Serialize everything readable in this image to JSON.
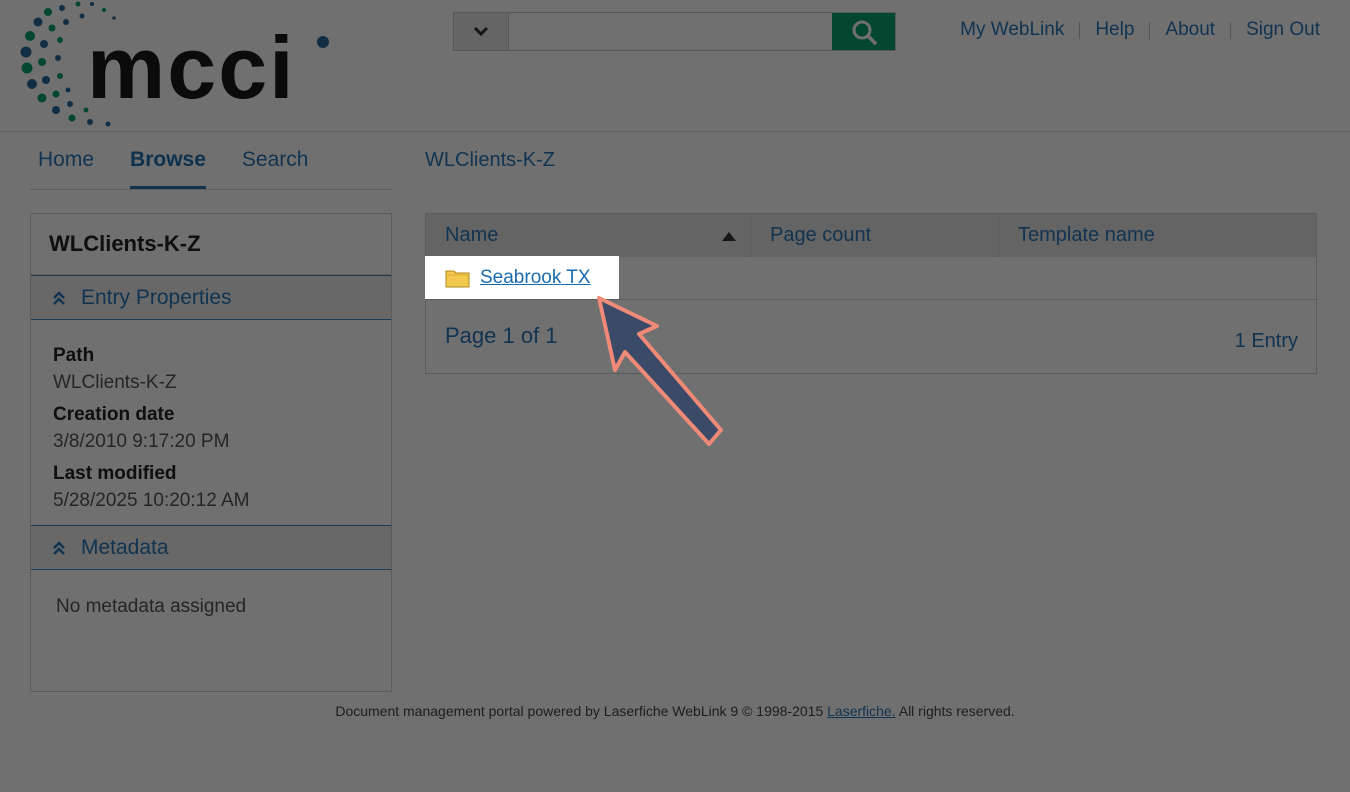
{
  "header": {
    "logo_text": "mcci",
    "search": {
      "placeholder": "",
      "dropdown_icon": "chevron-down-icon",
      "button_icon": "search-icon",
      "button_color": "#0aa36e"
    },
    "links": [
      "My WebLink",
      "Help",
      "About",
      "Sign Out"
    ]
  },
  "nav": {
    "tabs": [
      "Home",
      "Browse",
      "Search"
    ],
    "active": "Browse"
  },
  "breadcrumb": "WLClients-K-Z",
  "panel": {
    "title": "WLClients-K-Z",
    "entry_properties_label": "Entry Properties",
    "properties": [
      {
        "label": "Path",
        "value": "WLClients-K-Z"
      },
      {
        "label": "Creation date",
        "value": "3/8/2010 9:17:20 PM"
      },
      {
        "label": "Last modified",
        "value": "5/28/2025 10:20:12 AM"
      }
    ],
    "metadata_label": "Metadata",
    "metadata_empty": "No metadata assigned"
  },
  "table": {
    "columns": [
      "Name",
      "Page count",
      "Template name"
    ],
    "rows": [
      {
        "name": "Seabrook TX",
        "icon": "folder-icon"
      }
    ],
    "page_info": "Page 1 of 1",
    "entry_count": "1 Entry"
  },
  "footer": {
    "text_before": "Document management portal powered by Laserfiche WebLink 9 © 1998-2015 ",
    "link": "Laserfiche.",
    "text_after": " All rights reserved."
  },
  "colors": {
    "accent": "#2a77b8",
    "search_button": "#0aa36e",
    "arrow_fill": "#3b4a66",
    "arrow_outline": "#f08a78"
  }
}
